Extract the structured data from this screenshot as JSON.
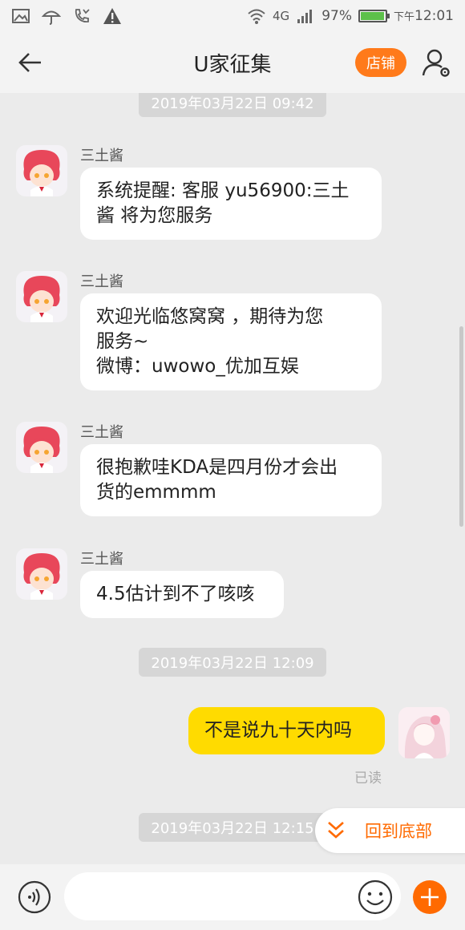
{
  "status": {
    "network": "4G",
    "battery": "97%",
    "battery_level": 0.97,
    "time_prefix": "下午",
    "time": "12:01"
  },
  "header": {
    "title": "U家征集",
    "shop_label": "店铺"
  },
  "messages": [
    {
      "timestamp": "2019年03月22日 09:42"
    },
    {
      "sender": "三土酱",
      "line1": "系统提醒: 客服 yu56900:三土",
      "line2": "酱 将为您服务"
    },
    {
      "sender": "三土酱",
      "line1": "欢迎光临悠窝窝 ，期待为您",
      "line2": "服务~",
      "line3": "微博：uwowo_优加互娱"
    },
    {
      "sender": "三土酱",
      "line1": "很抱歉哇KDA是四月份才会出",
      "line2": "货的emmmm"
    },
    {
      "sender": "三土酱",
      "line1": "4.5估计到不了咳咳"
    },
    {
      "timestamp": "2019年03月22日 12:09"
    },
    {
      "text": "不是说九十天内吗",
      "read": "已读"
    },
    {
      "timestamp": "2019年03月22日 12:15"
    }
  ],
  "back_to_bottom": "回到底部",
  "colors": {
    "accent": "#ff6a00",
    "my_bubble": "#ffdb00",
    "background": "#ebebeb"
  },
  "icons": [
    "gallery-icon",
    "umbrella-icon",
    "missed-call-icon",
    "warning-icon",
    "wifi-icon",
    "signal-icon",
    "back-arrow-icon",
    "user-settings-icon",
    "voice-icon",
    "emoji-icon",
    "plus-icon",
    "chevron-down-icon"
  ]
}
